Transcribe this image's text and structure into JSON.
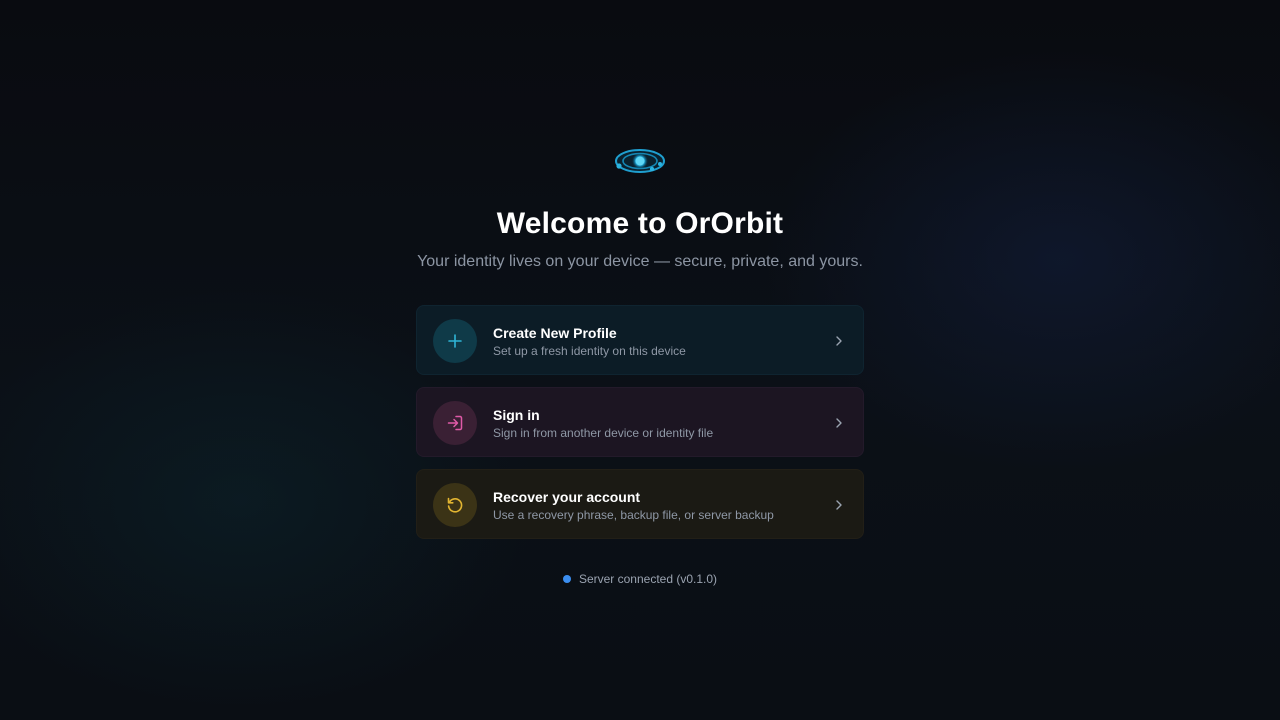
{
  "app": {
    "title": "Welcome to OrOrbit",
    "subtitle": "Your identity lives on your device — secure, private, and yours.",
    "logo_icon": "orbit-logo-icon"
  },
  "options": [
    {
      "label": "Create New Profile",
      "description": "Set up a fresh identity on this device",
      "icon": "plus-icon",
      "accent": "#29b6d6"
    },
    {
      "label": "Sign in",
      "description": "Sign in from another device or identity file",
      "icon": "sign-in-icon",
      "accent": "#e05aa8"
    },
    {
      "label": "Recover your account",
      "description": "Use a recovery phrase, backup file, or server backup",
      "icon": "restore-icon",
      "accent": "#e2b531"
    }
  ],
  "status": {
    "text": "Server connected (v0.1.0)",
    "color": "#3b8ef0"
  }
}
